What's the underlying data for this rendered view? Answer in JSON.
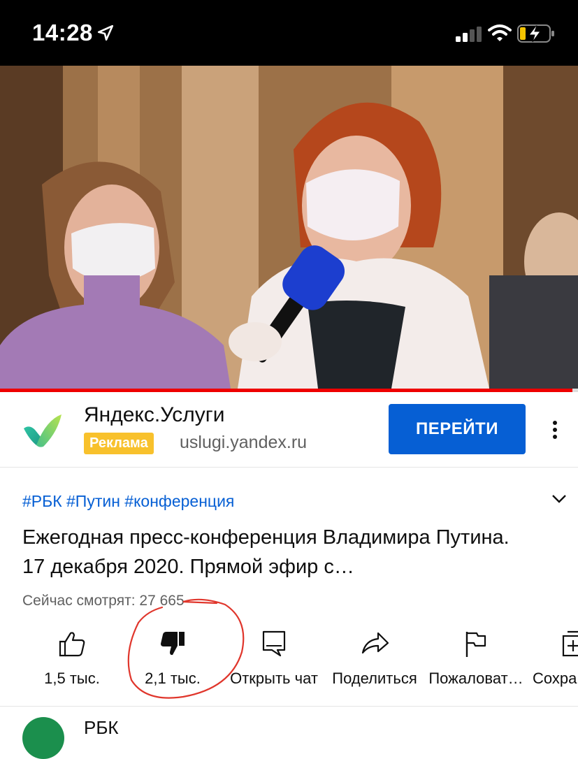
{
  "status_bar": {
    "time": "14:28"
  },
  "video": {
    "progress_fraction": 0.99
  },
  "ad": {
    "advertiser": "Яндекс.Услуги",
    "badge": "Реклама",
    "url": "uslugi.yandex.ru",
    "cta_label": "ПЕРЕЙТИ"
  },
  "video_info": {
    "hashtags": "#РБК #Путин #конференция",
    "title": "Ежегодная пресс-конференция Владимира Путина. 17 декабря 2020. Прямой эфир с…",
    "viewers": "Сейчас смотрят: 27 665"
  },
  "actions": {
    "like": "1,5 тыс.",
    "dislike": "2,1 тыс.",
    "chat": "Открыть чат",
    "share": "Поделиться",
    "report": "Пожаловат…",
    "save": "Сохра"
  },
  "channel": {
    "name": "РБК"
  },
  "colors": {
    "accent": "#065fd4",
    "badge": "#f8c12c",
    "progress": "#ee0000",
    "annotation": "#e0362c"
  }
}
